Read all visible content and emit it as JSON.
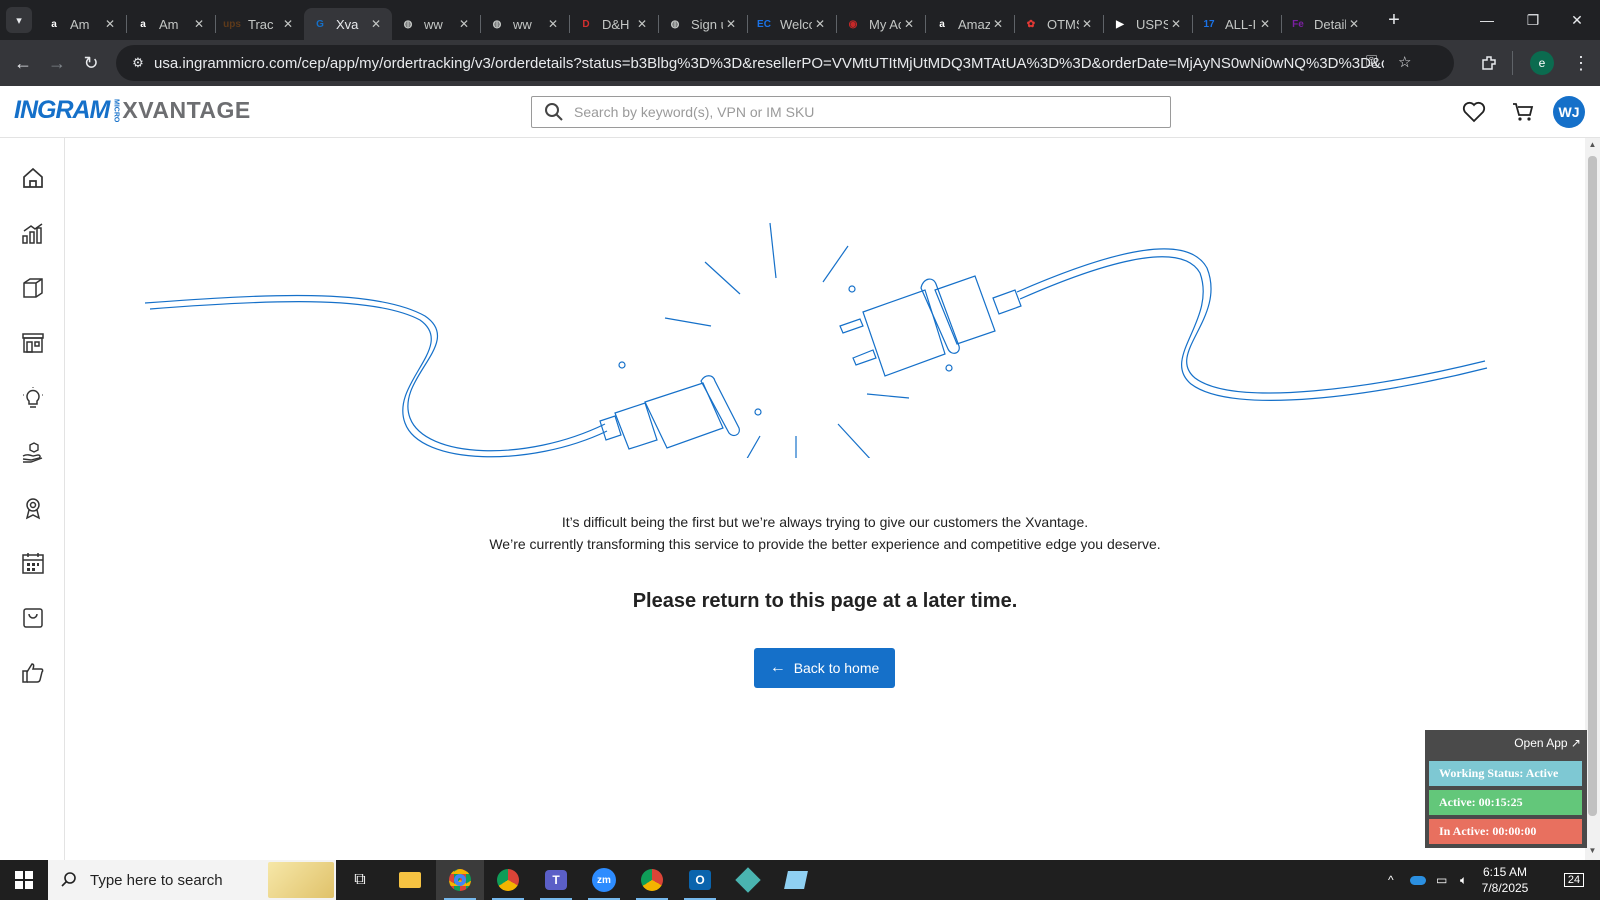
{
  "browser": {
    "tabs": [
      {
        "title": "Am",
        "favicon": "amazon-icon",
        "favicon_text": "a",
        "favicon_color": "#ffffff"
      },
      {
        "title": "Am",
        "favicon": "amazon-icon",
        "favicon_text": "a",
        "favicon_color": "#ffffff"
      },
      {
        "title": "Trac",
        "favicon": "ups-icon",
        "favicon_text": "ups",
        "favicon_color": "#5e3a1a"
      },
      {
        "title": "Xva",
        "favicon": "xvantage-icon",
        "favicon_text": "G",
        "favicon_color": "#1570c9",
        "active": true
      },
      {
        "title": "ww",
        "favicon": "globe-icon",
        "favicon_text": "◍",
        "favicon_color": "#c4c7c5"
      },
      {
        "title": "ww",
        "favicon": "globe-icon",
        "favicon_text": "◍",
        "favicon_color": "#c4c7c5"
      },
      {
        "title": "D&H Di",
        "favicon": "dandh-icon",
        "favicon_text": "D",
        "favicon_color": "#d32f2f"
      },
      {
        "title": "Sign up",
        "favicon": "globe-icon",
        "favicon_text": "◍",
        "favicon_color": "#c4c7c5"
      },
      {
        "title": "Welcom",
        "favicon": "ec-icon",
        "favicon_text": "EC",
        "favicon_color": "#1a73e8"
      },
      {
        "title": "My Acc",
        "favicon": "account-icon",
        "favicon_text": "◉",
        "favicon_color": "#c62828"
      },
      {
        "title": "Amazon",
        "favicon": "amazon-icon",
        "favicon_text": "a",
        "favicon_color": "#ffffff"
      },
      {
        "title": "OTMS",
        "favicon": "otms-icon",
        "favicon_text": "✿",
        "favicon_color": "#e53935"
      },
      {
        "title": "USPS.co",
        "favicon": "usps-icon",
        "favicon_text": "▶",
        "favicon_color": "#ffffff"
      },
      {
        "title": "ALL-IN-",
        "favicon": "17track-icon",
        "favicon_text": "17",
        "favicon_color": "#1a73e8"
      },
      {
        "title": "Detailed",
        "favicon": "fedex-icon",
        "favicon_text": "Fe",
        "favicon_color": "#7b1fa2"
      }
    ],
    "url": "usa.ingrammicro.com/cep/app/my/ordertracking/v3/orderdetails?status=b3Blbg%3D%3D&resellerPO=VVMtUTItMjUtMDQ3MTAtUA%3D%3D&orderDate=MjAyNS0wNi0wNQ%3D%3D&confirmati...",
    "profile_initial": "e"
  },
  "header": {
    "logo_ingram": "INGRAM",
    "logo_micro": "MICRO",
    "logo_xvantage": "XVANTAGE",
    "search_placeholder": "Search by keyword(s), VPN or IM SKU",
    "avatar_initials": "WJ",
    "brand_color": "#1570c9"
  },
  "sidebar": {
    "items": [
      {
        "name": "home-icon"
      },
      {
        "name": "analytics-icon"
      },
      {
        "name": "orders-box-icon"
      },
      {
        "name": "store-icon"
      },
      {
        "name": "lightbulb-icon"
      },
      {
        "name": "hand-box-icon"
      },
      {
        "name": "award-icon"
      },
      {
        "name": "calendar-icon"
      },
      {
        "name": "shopping-bag-icon"
      },
      {
        "name": "thumbs-up-icon"
      }
    ]
  },
  "main": {
    "line1": "It’s difficult being the first but we’re always trying to give our customers the Xvantage.",
    "line2": "We’re currently transforming this service to provide the better experience and competitive edge you deserve.",
    "title": "Please return to this page at a later time.",
    "back_button": "Back to home"
  },
  "widget": {
    "open_app": "Open App ↗",
    "working_status": "Working Status: Active",
    "active": "Active: 00:15:25",
    "inactive": "In Active: 00:00:00",
    "colors": {
      "status": "#7ec8d3",
      "active": "#63c77a",
      "inactive": "#e8705f"
    }
  },
  "taskbar": {
    "search_text": "Type here to search",
    "time": "6:15 AM",
    "date": "7/8/2025",
    "notifications": "24"
  }
}
